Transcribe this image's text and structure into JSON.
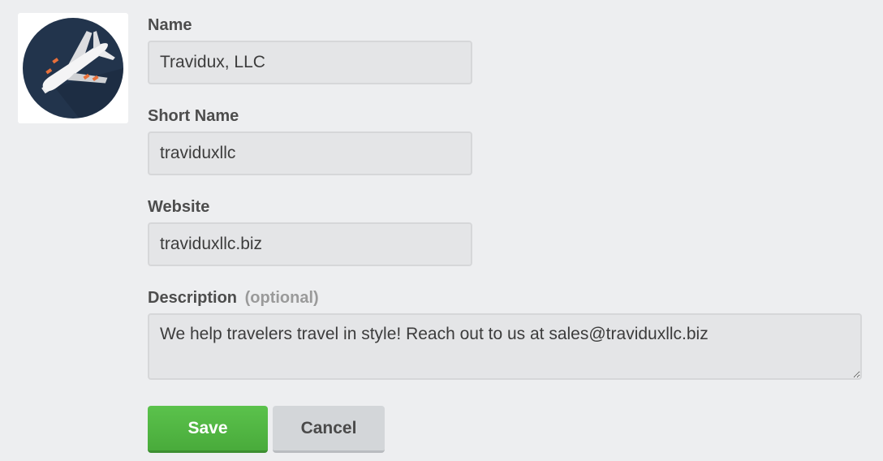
{
  "logo": {
    "icon": "airplane-icon",
    "background_color": "#22344c",
    "accent_color": "#e8703a"
  },
  "fields": {
    "name": {
      "label": "Name",
      "value": "Travidux, LLC"
    },
    "short_name": {
      "label": "Short Name",
      "value": "traviduxllc"
    },
    "website": {
      "label": "Website",
      "value": "traviduxllc.biz"
    },
    "description": {
      "label": "Description",
      "optional_tag": "(optional)",
      "value": "We help travelers travel in style! Reach out to us at sales@traviduxllc.biz"
    }
  },
  "actions": {
    "save_label": "Save",
    "cancel_label": "Cancel",
    "save_color": "#52b943"
  }
}
